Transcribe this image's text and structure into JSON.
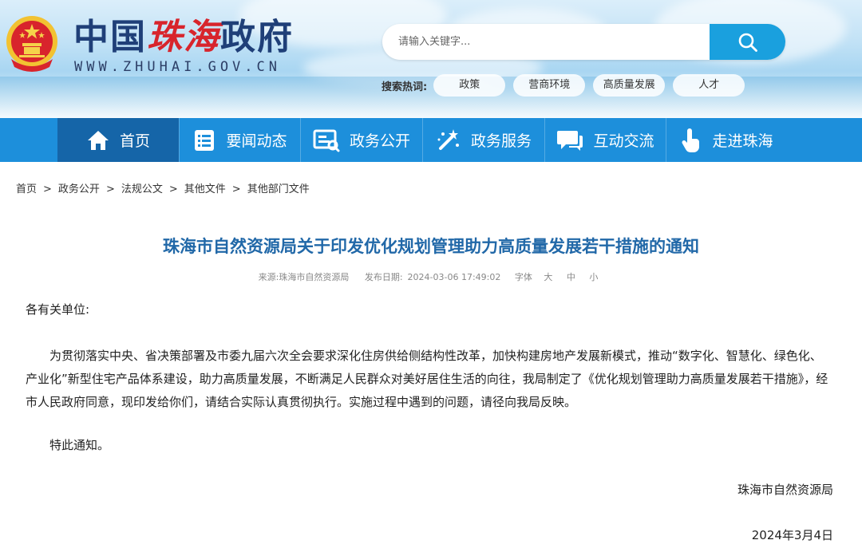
{
  "header": {
    "logo_prefix": "中国",
    "logo_highlight": "珠海",
    "logo_suffix": "政府",
    "logo_url_text": "WWW.ZHUHAI.GOV.CN",
    "search": {
      "placeholder": "请输入关键字..."
    },
    "hot_label": "搜索热词:",
    "hot_tags": [
      "政策",
      "营商环境",
      "高质量发展",
      "人才"
    ]
  },
  "nav": {
    "items": [
      {
        "label": "首页",
        "icon": "home-icon"
      },
      {
        "label": "要闻动态",
        "icon": "news-list-icon"
      },
      {
        "label": "政务公开",
        "icon": "disclosure-icon"
      },
      {
        "label": "政务服务",
        "icon": "service-wand-icon"
      },
      {
        "label": "互动交流",
        "icon": "chat-icon"
      },
      {
        "label": "走进珠海",
        "icon": "pointer-hand-icon"
      }
    ]
  },
  "breadcrumb": [
    "首页",
    "政务公开",
    "法规公文",
    "其他文件",
    "其他部门文件"
  ],
  "breadcrumb_sep": ">",
  "article": {
    "title": "珠海市自然资源局关于印发优化规划管理助力高质量发展若干措施的通知",
    "source_label": "来源:",
    "source": "珠海市自然资源局",
    "date_label": "发布日期:",
    "date": "2024-03-06 17:49:02",
    "font_label": "字体",
    "font_sizes": [
      "大",
      "中",
      "小"
    ],
    "salutation": "各有关单位:",
    "body": "为贯彻落实中央、省决策部署及市委九届六次全会要求深化住房供给侧结构性改革，加快构建房地产发展新模式，推动“数字化、智慧化、绿色化、产业化”新型住宅产品体系建设，助力高质量发展，不断满足人民群众对美好居住生活的向往，我局制定了《优化规划管理助力高质量发展若干措施》，经市人民政府同意，现印发给你们，请结合实际认真贯彻执行。实施过程中遇到的问题，请径向我局反映。",
    "closing": "特此通知。",
    "signature": "珠海市自然资源局",
    "sign_date": "2024年3月4日"
  },
  "colors": {
    "nav_bg": "#1d8fdb",
    "nav_active": "#1565a8",
    "title": "#2168a8",
    "search_btn": "#1aa0de",
    "logo_red": "#d8242c"
  }
}
